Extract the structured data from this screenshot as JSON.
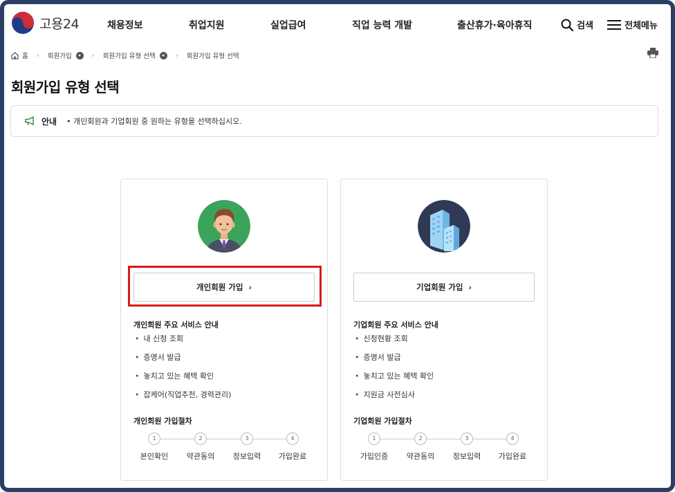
{
  "header": {
    "logo_text": "고용24",
    "nav": [
      "채용정보",
      "취업지원",
      "실업급여",
      "직업 능력 개발",
      "출산휴가·육아휴직"
    ],
    "search_label": "검색",
    "menu_label": "전체메뉴"
  },
  "breadcrumb": [
    "홈",
    "회원가입",
    "회원가입 유형 선택",
    "회원가입 유형 선택"
  ],
  "page_title": "회원가입 유형 선택",
  "notice": {
    "label": "안내",
    "text": "• 개인회원과 기업회원 중 원하는 유형을 선택하십시오."
  },
  "cards": [
    {
      "button_label": "개인회원 가입",
      "service_title": "개인회원 주요 서비스 안내",
      "services": [
        "내 신청 조회",
        "증명서 발급",
        "놓치고 있는 혜택 확인",
        "잡케어(직업추천, 경력관리)"
      ],
      "steps_title": "개인회원 가입절차",
      "steps": [
        {
          "num": "1",
          "label": "본인확인"
        },
        {
          "num": "2",
          "label": "약관동의"
        },
        {
          "num": "3",
          "label": "정보입력"
        },
        {
          "num": "4",
          "label": "가입완료"
        }
      ]
    },
    {
      "button_label": "기업회원 가입",
      "service_title": "기업회원 주요 서비스 안내",
      "services": [
        "신청현황 조회",
        "증명서 발급",
        "놓치고 있는 혜택 확인",
        "지원금 사전심사"
      ],
      "steps_title": "기업회원 가입절차",
      "steps": [
        {
          "num": "1",
          "label": "가입인증"
        },
        {
          "num": "2",
          "label": "약관동의"
        },
        {
          "num": "3",
          "label": "정보입력"
        },
        {
          "num": "4",
          "label": "가입완료"
        }
      ]
    }
  ],
  "icons": {
    "logo": "taegeuk-logo-icon",
    "search": "search-icon",
    "menu": "hamburger-icon",
    "home": "home-icon",
    "print": "print-icon",
    "notice": "megaphone-icon",
    "personal": "person-avatar-icon",
    "business": "building-icon"
  },
  "colors": {
    "frame": "#2b3e63",
    "highlight": "#d81a1a",
    "personal_bg": "#3aa45a",
    "business_bg": "#2f3a57",
    "notice_icon": "#2d8a3e"
  }
}
